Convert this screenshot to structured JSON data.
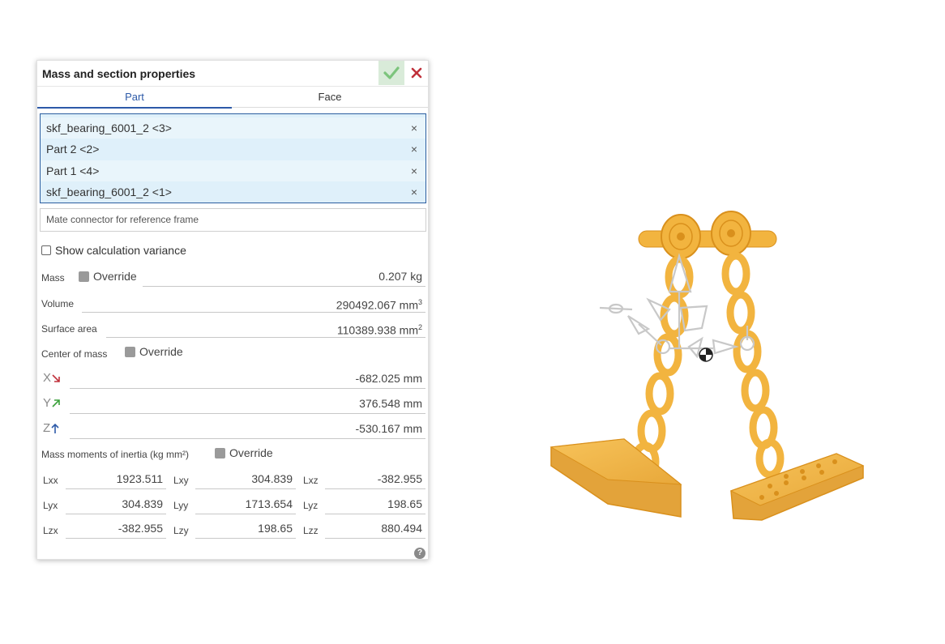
{
  "dialog": {
    "title": "Mass and section properties",
    "tabs": [
      {
        "label": "Part",
        "active": true
      },
      {
        "label": "Face",
        "active": false
      }
    ],
    "selected_parts": [
      {
        "label": "skf_bearing_6001_2 <3>"
      },
      {
        "label": "Part 2 <2>"
      },
      {
        "label": "Part 1 <4>"
      },
      {
        "label": "skf_bearing_6001_2 <1>"
      }
    ],
    "remove_glyph": "×",
    "mate_connector_placeholder": "Mate connector for reference frame",
    "show_variance_label": "Show calculation variance",
    "override_label": "Override",
    "mass": {
      "label": "Mass",
      "value": "0.207 kg"
    },
    "volume": {
      "label": "Volume",
      "value": "290492.067 mm",
      "unit_sup": "3"
    },
    "surface_area": {
      "label": "Surface area",
      "value": "110389.938 mm",
      "unit_sup": "2"
    },
    "center_of_mass": {
      "label": "Center of mass",
      "x": {
        "axis": "X",
        "value": "-682.025 mm"
      },
      "y": {
        "axis": "Y",
        "value": "376.548 mm"
      },
      "z": {
        "axis": "Z",
        "value": "-530.167 mm"
      }
    },
    "inertia": {
      "label": "Mass moments of inertia (kg mm²)",
      "rows": [
        [
          {
            "k": "Lxx",
            "v": "1923.511"
          },
          {
            "k": "Lxy",
            "v": "304.839"
          },
          {
            "k": "Lxz",
            "v": "-382.955"
          }
        ],
        [
          {
            "k": "Lyx",
            "v": "304.839"
          },
          {
            "k": "Lyy",
            "v": "1713.654"
          },
          {
            "k": "Lyz",
            "v": "198.65"
          }
        ],
        [
          {
            "k": "Lzx",
            "v": "-382.955"
          },
          {
            "k": "Lzy",
            "v": "198.65"
          },
          {
            "k": "Lzz",
            "v": "880.494"
          }
        ]
      ]
    },
    "help_glyph": "?"
  },
  "colors": {
    "accent_blue": "#2d5aa8",
    "ok_green": "#7cc47c",
    "cancel_red": "#c0313b",
    "part_orange": "#f2b43f",
    "part_edge": "#d9901c",
    "axis_x": "#c0313b",
    "axis_y": "#3aa13a",
    "axis_z": "#2d5aa8"
  }
}
